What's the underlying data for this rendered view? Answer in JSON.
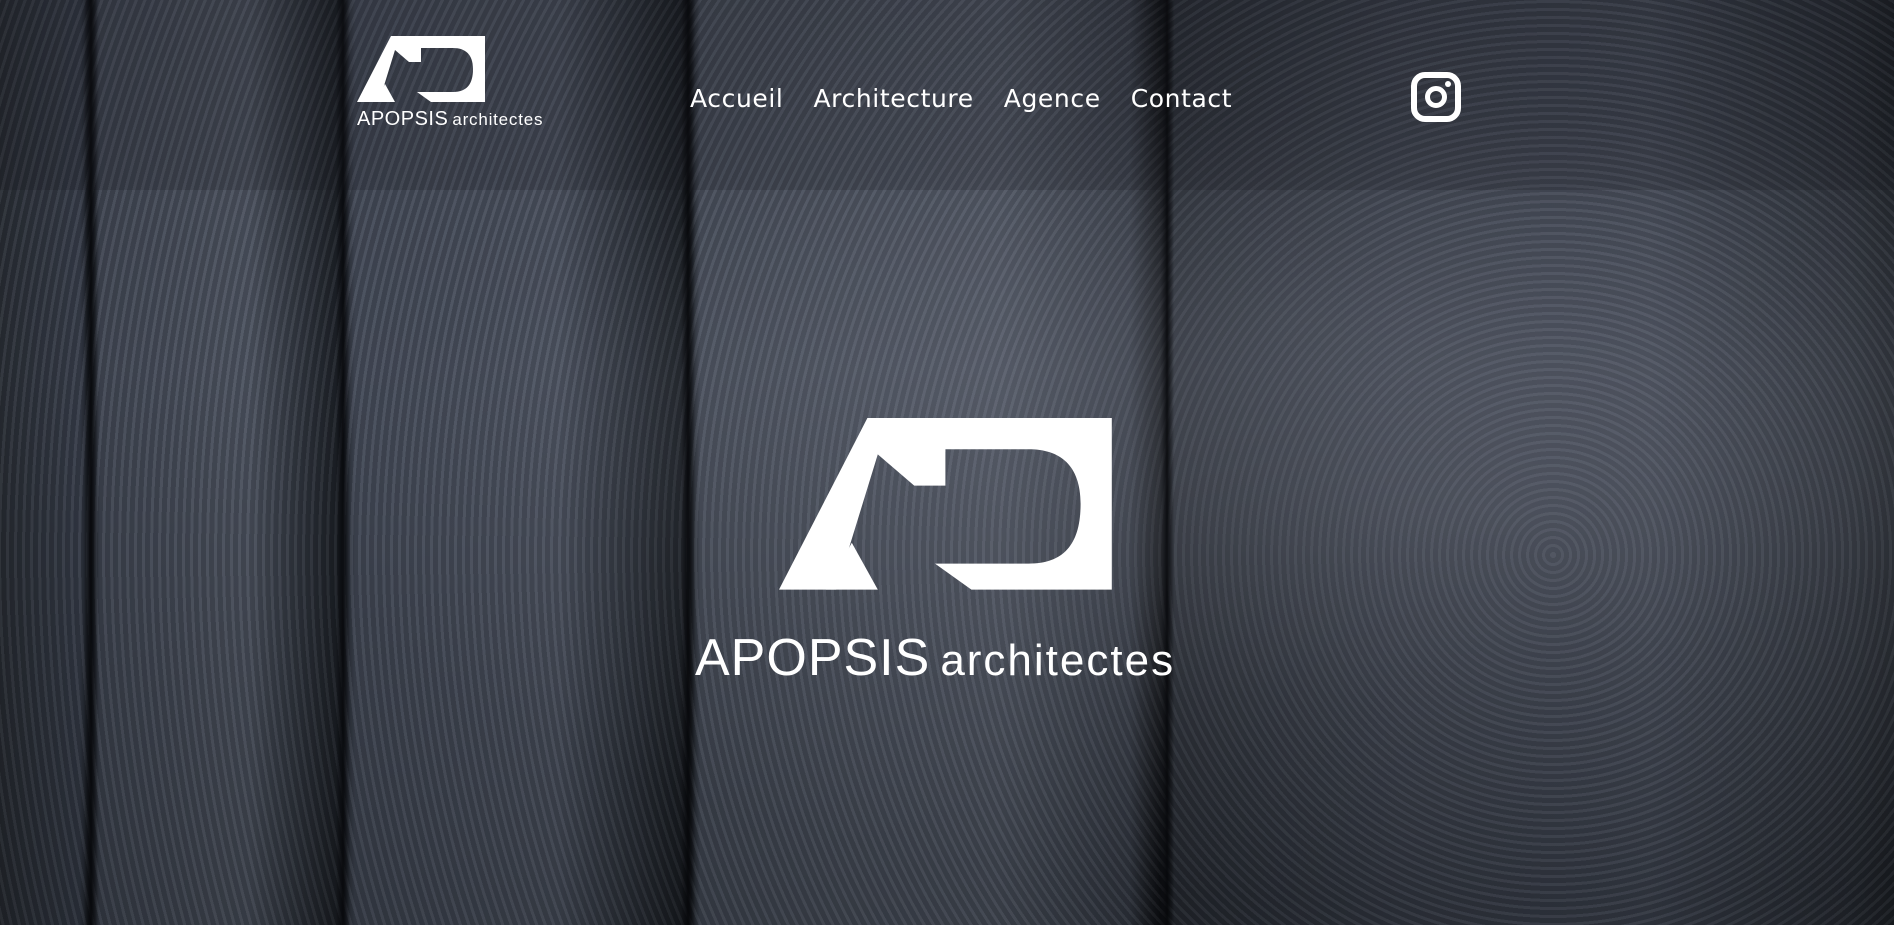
{
  "brand": {
    "name_primary": "APOPSIS",
    "name_secondary": "architectes",
    "logo_icon": "ad-monogram-logo",
    "text_color": "#ffffff"
  },
  "nav": {
    "items": [
      {
        "label": "Accueil"
      },
      {
        "label": "Architecture"
      },
      {
        "label": "Agence"
      },
      {
        "label": "Contact"
      }
    ]
  },
  "social": {
    "icon": "instagram-icon"
  },
  "hero": {
    "background": "charred-wood-planks",
    "name_primary": "APOPSIS",
    "name_secondary": "architectes"
  }
}
